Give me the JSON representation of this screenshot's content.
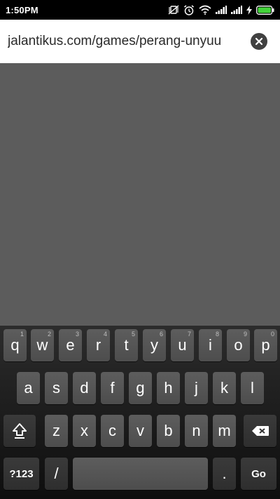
{
  "status_bar": {
    "time": "1:50PM",
    "icons": [
      "vibrate-off-icon",
      "alarm-icon",
      "wifi-icon",
      "signal-icon",
      "signal-icon",
      "charging-icon",
      "battery-icon"
    ]
  },
  "url_bar": {
    "url": "jalantikus.com/games/perang-unyuu",
    "clear_icon": "close-circle-icon"
  },
  "keyboard": {
    "row1": [
      {
        "label": "q",
        "hint": "1"
      },
      {
        "label": "w",
        "hint": "2"
      },
      {
        "label": "e",
        "hint": "3"
      },
      {
        "label": "r",
        "hint": "4"
      },
      {
        "label": "t",
        "hint": "5"
      },
      {
        "label": "y",
        "hint": "6"
      },
      {
        "label": "u",
        "hint": "7"
      },
      {
        "label": "i",
        "hint": "8"
      },
      {
        "label": "o",
        "hint": "9"
      },
      {
        "label": "p",
        "hint": "0"
      }
    ],
    "row2": [
      "a",
      "s",
      "d",
      "f",
      "g",
      "h",
      "j",
      "k",
      "l"
    ],
    "row3": [
      "z",
      "x",
      "c",
      "v",
      "b",
      "n",
      "m"
    ],
    "shift_icon": "shift-arrow-icon",
    "backspace_icon": "backspace-icon",
    "symbols_label": "?123",
    "slash_label": "/",
    "period_label": ".",
    "go_label": "Go",
    "colors": {
      "key": "#555555",
      "background": "#1a1a1a",
      "content": "#5c5c5c"
    }
  }
}
